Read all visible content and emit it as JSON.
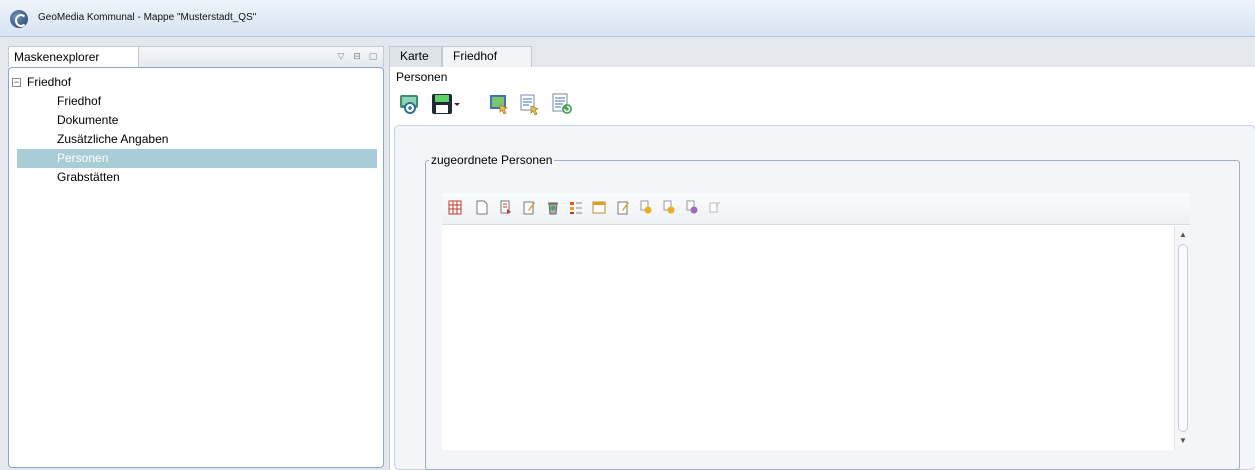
{
  "window": {
    "title": "GeoMedia Kommunal - Mappe \"Musterstadt_QS\""
  },
  "left_panel": {
    "tab_label": "Maskenexplorer",
    "tree": {
      "root_label": "Friedhof",
      "items": [
        {
          "label": "Friedhof",
          "selected": false
        },
        {
          "label": "Dokumente",
          "selected": false
        },
        {
          "label": "Zusätzliche Angaben",
          "selected": false
        },
        {
          "label": "Personen",
          "selected": true
        },
        {
          "label": "Grabstätten",
          "selected": false
        }
      ]
    }
  },
  "right_panel": {
    "tabs": [
      {
        "label": "Karte",
        "active": false
      },
      {
        "label": "Friedhof",
        "active": true
      }
    ],
    "section_title": "Personen",
    "toolbar_icons": [
      "zoom-to-map-icon",
      "save-dropdown-icon",
      "map-select-icon",
      "edit-record-icon",
      "refresh-list-icon"
    ],
    "fieldset_label": "zugeordnete Personen",
    "grid_toolbar_icons": [
      "table-icon",
      "new-icon",
      "attach-icon",
      "edit-icon",
      "delete-icon",
      "list-icon",
      "form-icon",
      "edit2-icon",
      "link-icon",
      "link2-icon",
      "link3-icon",
      "unlink-icon"
    ]
  },
  "colors": {
    "selection": "#a8cdd6",
    "accent_border": "#8aa6c7",
    "titlebar_top": "#eef4fb",
    "titlebar_bottom": "#d6e3f1"
  }
}
